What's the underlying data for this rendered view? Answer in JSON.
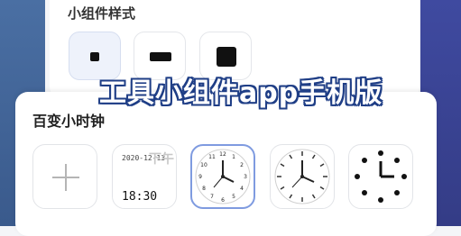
{
  "widget_style": {
    "title": "小组件样式",
    "options": [
      {
        "name": "small-square",
        "selected": true
      },
      {
        "name": "wide-bar",
        "selected": false
      },
      {
        "name": "large-square",
        "selected": false
      }
    ]
  },
  "watermark": "工具小组件app手机版",
  "clock_section": {
    "title": "百变小时钟",
    "digital": {
      "date": "2020-12-13",
      "ampm": "下午",
      "time": "18:30"
    }
  },
  "colors": {
    "selected_border": "#7f9be0",
    "watermark_outline": "#1f3e86"
  }
}
